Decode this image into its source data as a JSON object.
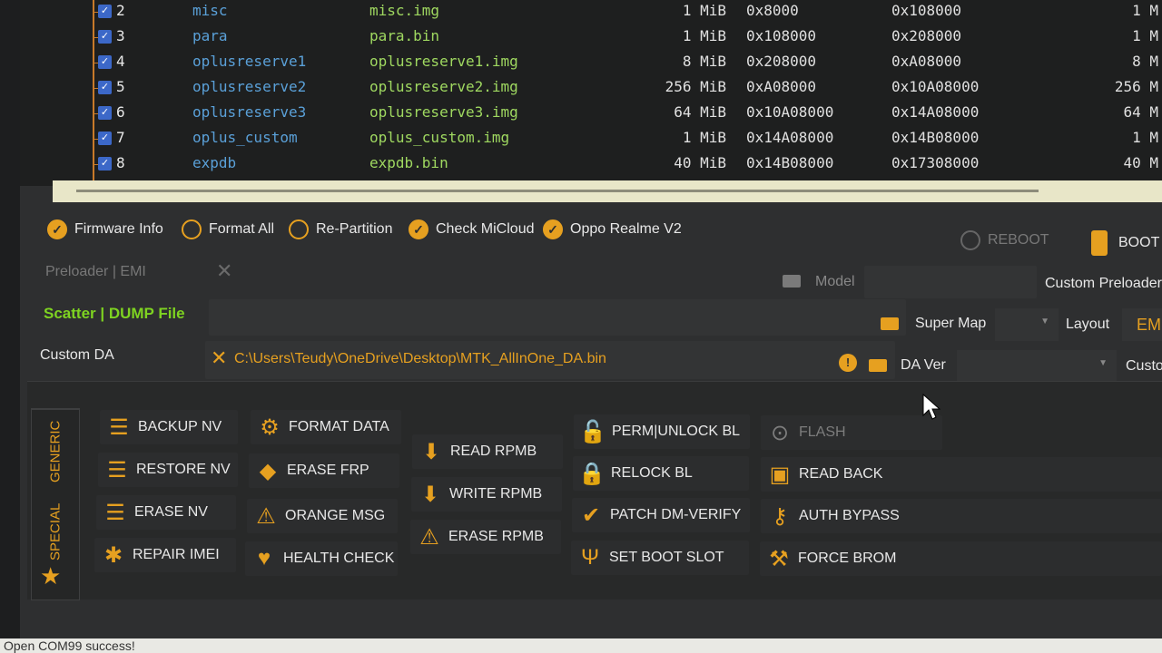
{
  "partitions": [
    {
      "idx": "2",
      "name": "misc",
      "file": "misc.img",
      "size": "1 MiB",
      "start": "0x8000",
      "end": "0x108000",
      "len": "1 M"
    },
    {
      "idx": "3",
      "name": "para",
      "file": "para.bin",
      "size": "1 MiB",
      "start": "0x108000",
      "end": "0x208000",
      "len": "1 M"
    },
    {
      "idx": "4",
      "name": "oplusreserve1",
      "file": "oplusreserve1.img",
      "size": "8 MiB",
      "start": "0x208000",
      "end": "0xA08000",
      "len": "8 M"
    },
    {
      "idx": "5",
      "name": "oplusreserve2",
      "file": "oplusreserve2.img",
      "size": "256 MiB",
      "start": "0xA08000",
      "end": "0x10A08000",
      "len": "256 M"
    },
    {
      "idx": "6",
      "name": "oplusreserve3",
      "file": "oplusreserve3.img",
      "size": "64 MiB",
      "start": "0x10A08000",
      "end": "0x14A08000",
      "len": "64 M"
    },
    {
      "idx": "7",
      "name": "oplus_custom",
      "file": "oplus_custom.img",
      "size": "1 MiB",
      "start": "0x14A08000",
      "end": "0x14B08000",
      "len": "1 M"
    },
    {
      "idx": "8",
      "name": "expdb",
      "file": "expdb.bin",
      "size": "40 MiB",
      "start": "0x14B08000",
      "end": "0x17308000",
      "len": "40 M"
    }
  ],
  "options": {
    "firmware_info": "Firmware Info",
    "format_all": "Format All",
    "re_partition": "Re-Partition",
    "check_micloud": "Check MiCloud",
    "oppo_realme": "Oppo Realme V2",
    "reboot": "REBOOT",
    "boot": "BOOT"
  },
  "fields": {
    "preloader_label": "Preloader | EMI",
    "model_label": "Model",
    "custom_preloader_label": "Custom Preloader",
    "scatter_label": "Scatter | DUMP File",
    "super_map_label": "Super Map",
    "layout_label": "Layout",
    "layout_value": "EMI",
    "custom_da_label": "Custom DA",
    "custom_da_path": "C:\\Users\\Teudy\\OneDrive\\Desktop\\MTK_AllInOne_DA.bin",
    "da_ver_label": "DA Ver",
    "custom_cut_label": "Custo"
  },
  "tabs": {
    "generic": "GENERIC",
    "special": "SPECIAL"
  },
  "buttons": {
    "backup_nv": "BACKUP NV",
    "restore_nv": "RESTORE NV",
    "erase_nv": "ERASE NV",
    "repair_imei": "REPAIR IMEI",
    "format_data": "FORMAT DATA",
    "erase_frp": "ERASE FRP",
    "orange_msg": "ORANGE MSG",
    "health_check": "HEALTH CHECK",
    "read_rpmb": "READ RPMB",
    "write_rpmb": "WRITE RPMB",
    "erase_rpmb": "ERASE RPMB",
    "perm_unlock": "PERM|UNLOCK BL",
    "relock_bl": "RELOCK BL",
    "patch_dm": "PATCH DM-VERIFY",
    "set_boot_slot": "SET BOOT SLOT",
    "flash": "FLASH",
    "read_back": "READ BACK",
    "auth_bypass": "AUTH BYPASS",
    "force_brom": "FORCE BROM"
  },
  "status": "Open COM99 success!"
}
